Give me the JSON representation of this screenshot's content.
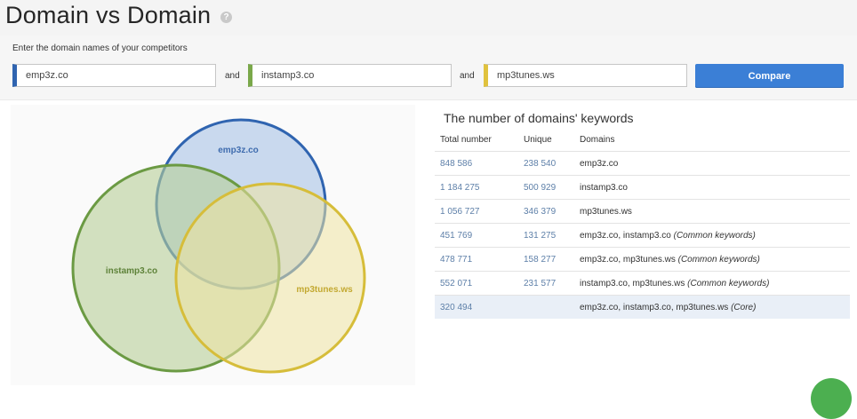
{
  "page": {
    "title": "Domain vs Domain",
    "help_glyph": "?"
  },
  "form": {
    "label": "Enter the domain names of your competitors",
    "inputs": [
      {
        "value": "emp3z.co",
        "accent": "#2f64b0"
      },
      {
        "value": "instamp3.co",
        "accent": "#7aa84a"
      },
      {
        "value": "mp3tunes.ws",
        "accent": "#e0c23e"
      }
    ],
    "and_label": "and",
    "compare_label": "Compare"
  },
  "venn": {
    "circles": [
      {
        "label": "emp3z.co",
        "fill": "#a9c3e6",
        "stroke": "#2f64b0",
        "label_color": "#3f6cae"
      },
      {
        "label": "instamp3.co",
        "fill": "#b7cf98",
        "stroke": "#6b9a43",
        "label_color": "#5e8239"
      },
      {
        "label": "mp3tunes.ws",
        "fill": "#efe3a2",
        "stroke": "#d6bd3a",
        "label_color": "#c3a932"
      }
    ]
  },
  "table": {
    "title": "The number of domains' keywords",
    "headers": {
      "total": "Total number",
      "unique": "Unique",
      "domains": "Domains"
    },
    "rows": [
      {
        "total": "848 586",
        "unique": "238 540",
        "domains": "emp3z.co",
        "note": ""
      },
      {
        "total": "1 184 275",
        "unique": "500 929",
        "domains": "instamp3.co",
        "note": ""
      },
      {
        "total": "1 056 727",
        "unique": "346 379",
        "domains": "mp3tunes.ws",
        "note": ""
      },
      {
        "total": "451 769",
        "unique": "131 275",
        "domains": "emp3z.co, instamp3.co",
        "note": "(Common keywords)"
      },
      {
        "total": "478 771",
        "unique": "158 277",
        "domains": "emp3z.co, mp3tunes.ws",
        "note": "(Common keywords)"
      },
      {
        "total": "552 071",
        "unique": "231 577",
        "domains": "instamp3.co, mp3tunes.ws",
        "note": "(Common keywords)"
      },
      {
        "total": "320 494",
        "unique": "",
        "domains": "emp3z.co, instamp3.co, mp3tunes.ws",
        "note": "(Core)"
      }
    ]
  }
}
